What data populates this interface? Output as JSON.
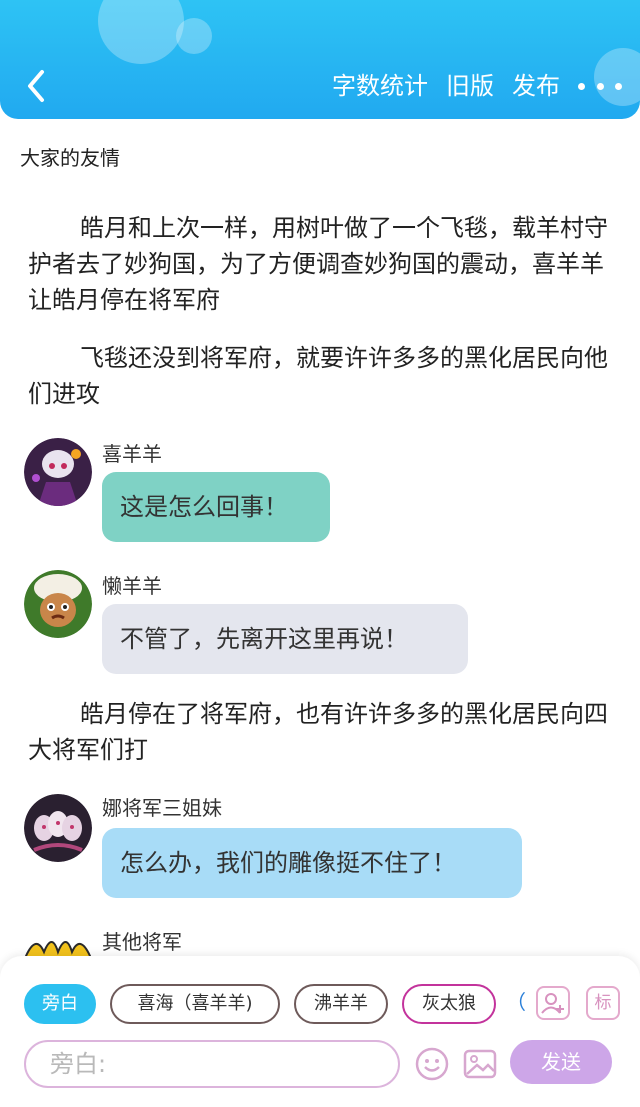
{
  "header": {
    "back_icon": "chevron-left-icon",
    "word_count": "字数统计",
    "old_version": "旧版",
    "publish": "发布",
    "more_icon": "more-horizontal-icon",
    "background_color": "#22aaf0"
  },
  "story": {
    "title": "大家的友情",
    "paragraphs": [
      "皓月和上次一样，用树叶做了一个飞毯，载羊村守护者去了妙狗国，为了方便调查妙狗国的震动，喜羊羊让皓月停在将军府",
      "飞毯还没到将军府，就要许许多多的黑化居民向他们进攻",
      "皓月停在了将军府，也有许许多多的黑化居民向四大将军们打"
    ],
    "messages": [
      {
        "speaker": "喜羊羊",
        "text": "这是怎么回事！",
        "bubble_color": "#7fd2c5"
      },
      {
        "speaker": "懒羊羊",
        "text": "不管了，先离开这里再说！",
        "bubble_color": "#e4e6ee"
      },
      {
        "speaker": "娜将军三姐妹",
        "text": "怎么办，我们的雕像挺不住了！",
        "bubble_color": "#a8dcf7"
      },
      {
        "speaker": "其他将军"
      }
    ]
  },
  "composer": {
    "roles": [
      "旁白",
      "喜海（喜羊羊)",
      "沸羊羊",
      "灰太狼",
      "（"
    ],
    "role_add_icon": "person-add-icon",
    "tag_button": "标",
    "input_placeholder": "旁白:",
    "emoji_icon": "smiley-icon",
    "image_icon": "image-icon",
    "send": "发送",
    "send_color": "#cda6e8"
  }
}
